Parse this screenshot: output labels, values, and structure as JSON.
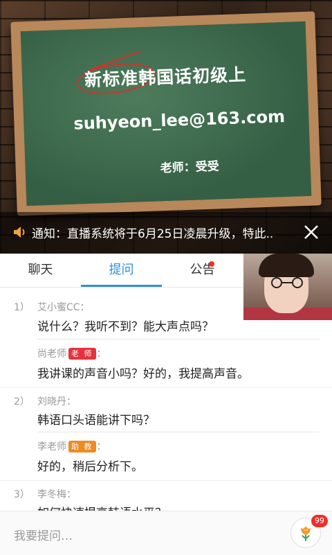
{
  "video": {
    "board_title": "新标准韩国话初级上",
    "board_email": "suhyeon_lee@163.com",
    "board_teacher": "老师：受受"
  },
  "notice": {
    "text": "通知：直播系统将于6月25日凌晨升级，特此.."
  },
  "tabs": [
    {
      "label": "聊天",
      "active": false
    },
    {
      "label": "提问",
      "active": true
    },
    {
      "label": "公告",
      "active": false,
      "has_dot": true
    }
  ],
  "qa": [
    {
      "num": "1）",
      "asker": "艾小蜜CC：",
      "question": "说什么？我听不到？能大声点吗？",
      "reply": {
        "name": "尚老师",
        "badge": "老 师",
        "badge_type": "teacher",
        "text": "我讲课的声音小吗？好的，我提高声音。"
      }
    },
    {
      "num": "2）",
      "asker": "刘晓丹：",
      "question": "韩语口头语能讲下吗？",
      "reply": {
        "name": "李老师",
        "badge": "助 教",
        "badge_type": "assist",
        "text": "好的，稍后分析下。"
      }
    },
    {
      "num": "3）",
      "asker": "李冬梅：",
      "question": "如何快速提高韩语水平？"
    }
  ],
  "bottom": {
    "placeholder": "我要提问…",
    "flower_count": "99"
  },
  "colors": {
    "accent": "#2f8fe0",
    "teacher_badge": "#e5323d",
    "assist_badge": "#f08a1e",
    "notification_dot": "#e8312a"
  }
}
